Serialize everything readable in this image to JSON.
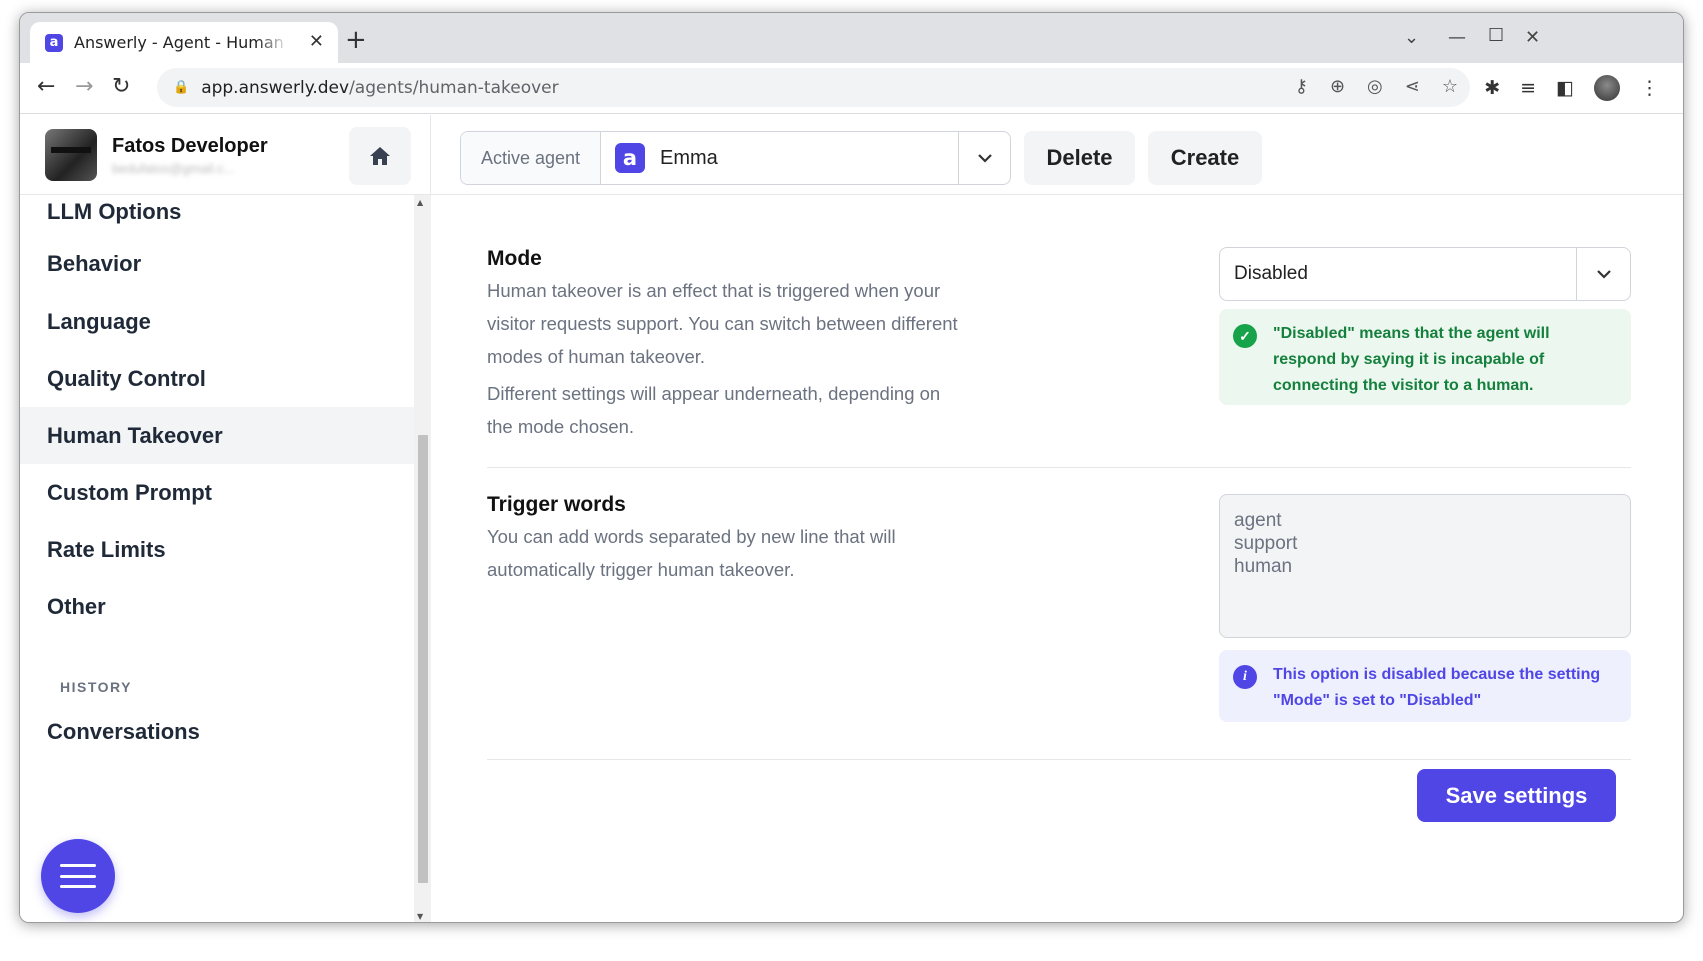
{
  "browser": {
    "tab_title": "Answerly - Agent - Human T",
    "url_host": "app.answerly.dev",
    "url_path": "/agents/human-takeover"
  },
  "user": {
    "name": "Fatos Developer",
    "email": "bedufatos@gmail.c..."
  },
  "sidebar": {
    "items": [
      {
        "label": "LLM Options"
      },
      {
        "label": "Behavior"
      },
      {
        "label": "Language"
      },
      {
        "label": "Quality Control"
      },
      {
        "label": "Human Takeover"
      },
      {
        "label": "Custom Prompt"
      },
      {
        "label": "Rate Limits"
      },
      {
        "label": "Other"
      }
    ],
    "history_heading": "HISTORY",
    "history_items": [
      {
        "label": "Conversations"
      }
    ]
  },
  "topbar": {
    "active_agent_label": "Active agent",
    "active_agent_value": "Emma",
    "delete_label": "Delete",
    "create_label": "Create"
  },
  "mode": {
    "title": "Mode",
    "desc1": "Human takeover is an effect that is triggered when your visitor requests support. You can switch between different modes of human takeover.",
    "desc2": "Different settings will appear underneath, depending on the mode chosen.",
    "selected": "Disabled",
    "alert": "\"Disabled\" means that the agent will respond by saying it is incapable of connecting the visitor to a human."
  },
  "trigger": {
    "title": "Trigger words",
    "desc": "You can add words separated by new line that will automatically trigger human takeover.",
    "value": "agent\nsupport\nhuman",
    "alert": "This option is disabled because the setting \"Mode\" is set to \"Disabled\""
  },
  "save_label": "Save settings",
  "colors": {
    "accent": "#4f46e5",
    "success_bg": "#ecf8ef",
    "success_text": "#15803d",
    "info_bg": "#eef0fe"
  }
}
